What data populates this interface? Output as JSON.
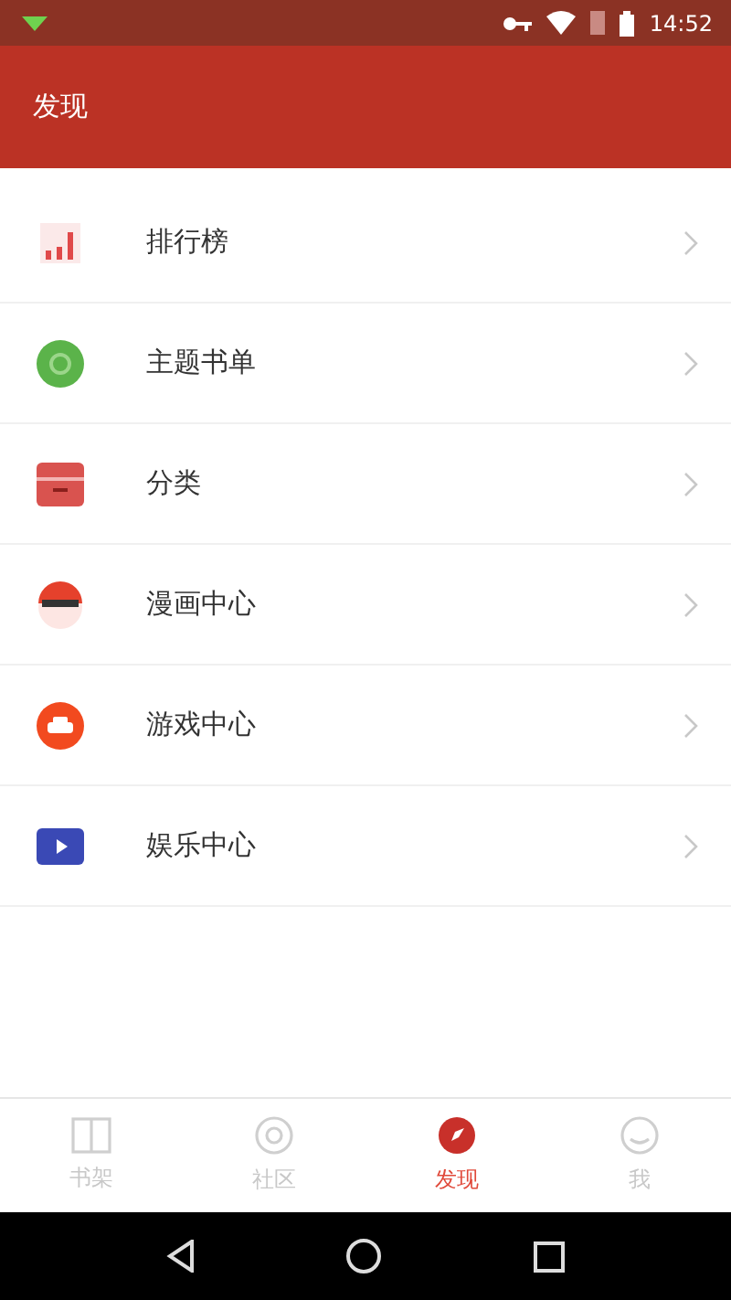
{
  "status_bar": {
    "time": "14:52"
  },
  "app_bar": {
    "title": "发现"
  },
  "menu": [
    {
      "label": "排行榜"
    },
    {
      "label": "主题书单"
    },
    {
      "label": "分类"
    },
    {
      "label": "漫画中心"
    },
    {
      "label": "游戏中心"
    },
    {
      "label": "娱乐中心"
    }
  ],
  "bottom_tabs": [
    {
      "label": "书架",
      "selected": false
    },
    {
      "label": "社区",
      "selected": false
    },
    {
      "label": "发现",
      "selected": true
    },
    {
      "label": "我",
      "selected": false
    }
  ]
}
